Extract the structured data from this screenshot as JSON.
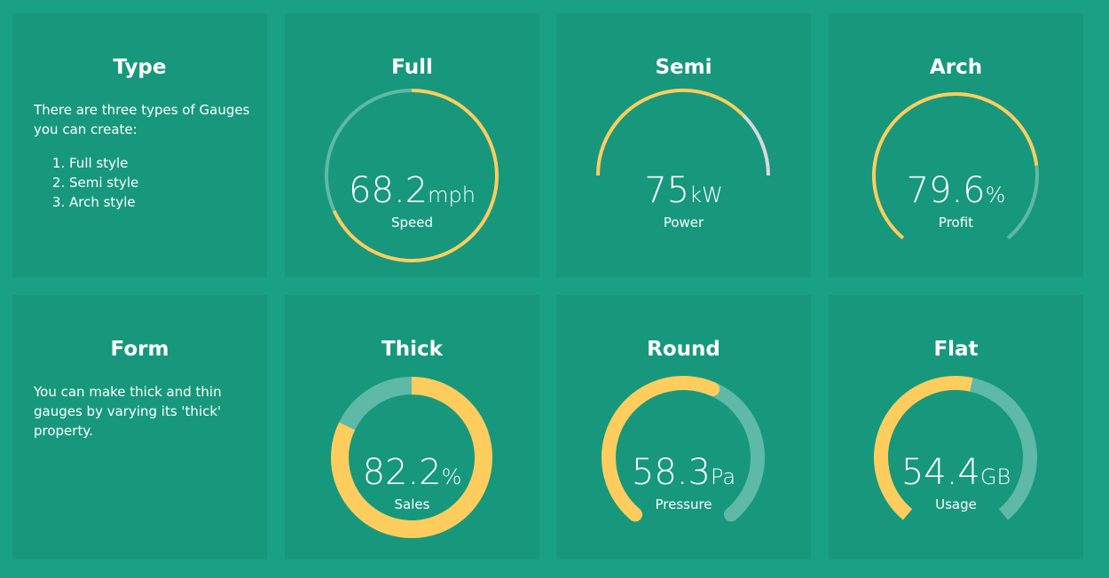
{
  "colors": {
    "background": "#1aa084",
    "card": "#17987c",
    "fill": "#ffcd5e",
    "track": "#5fb9a7",
    "track_grey": "#d7d9dc",
    "text": "#ffffff"
  },
  "type_card": {
    "title": "Type",
    "intro": "There are three types of Gauges you can create:",
    "items": [
      "Full style",
      "Semi style",
      "Arch style"
    ]
  },
  "form_card": {
    "title": "Form",
    "text": "You can make thick and thin gauges by varying its 'thick' property."
  },
  "gauges": {
    "full": {
      "title": "Full",
      "value": "68.2",
      "unit": "mph",
      "label": "Speed",
      "fraction": 0.682,
      "style": "full",
      "thick": "thin"
    },
    "semi": {
      "title": "Semi",
      "value": "75",
      "unit": "kW",
      "label": "Power",
      "fraction": 0.75,
      "style": "semi",
      "thick": "thin"
    },
    "arch": {
      "title": "Arch",
      "value": "79.6",
      "unit": "%",
      "label": "Profit",
      "fraction": 0.796,
      "style": "arch",
      "thick": "thin"
    },
    "thick": {
      "title": "Thick",
      "value": "82.2",
      "unit": "%",
      "label": "Sales",
      "fraction": 0.822,
      "style": "full",
      "thick": "thick"
    },
    "round": {
      "title": "Round",
      "value": "58.3",
      "unit": "Pa",
      "label": "Pressure",
      "fraction": 0.583,
      "style": "arch",
      "thick": "medium",
      "cap": "round"
    },
    "flat": {
      "title": "Flat",
      "value": "54.4",
      "unit": "GB",
      "label": "Usage",
      "fraction": 0.544,
      "style": "arch",
      "thick": "medium",
      "cap": "butt"
    }
  }
}
